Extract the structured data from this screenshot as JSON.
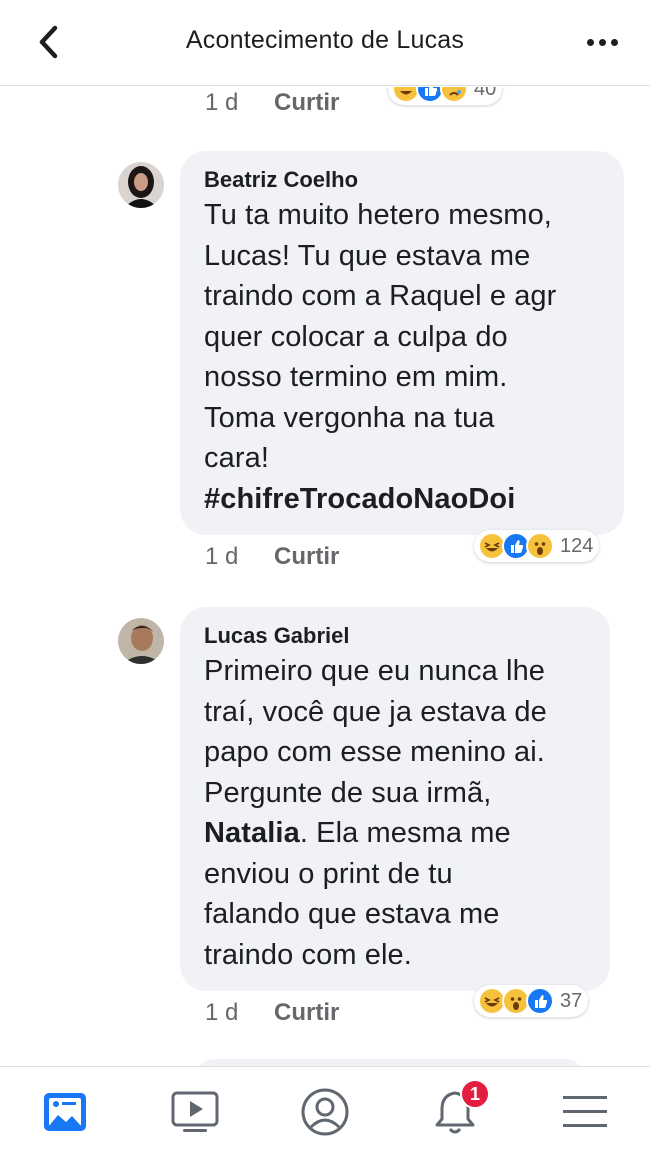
{
  "header": {
    "title": "Acontecimento de Lucas",
    "back_icon": "chevron-left-icon",
    "more_icon": "more-horizontal-icon"
  },
  "comments": [
    {
      "meta": {
        "time": "1 d",
        "like_label": "Curtir"
      },
      "reactions": {
        "icons": [
          "haha",
          "like",
          "sad"
        ],
        "count": "40"
      }
    },
    {
      "author": "Beatriz Coelho",
      "text_lines": [
        "Tu ta muito hetero mesmo,",
        "Lucas! Tu que estava me",
        "traindo com a Raquel e agr",
        "quer colocar a culpa do",
        "nosso termino em mim.",
        "Toma vergonha na tua",
        "cara!"
      ],
      "hashtag": "#chifreTrocadoNaoDoi",
      "meta": {
        "time": "1 d",
        "like_label": "Curtir"
      },
      "reactions": {
        "icons": [
          "haha",
          "like",
          "wow"
        ],
        "count": "124"
      }
    },
    {
      "author": "Lucas Gabriel",
      "text_lines": [
        "Primeiro que eu nunca lhe",
        "traí, você que ja estava de",
        "papo com esse menino ai.",
        "Pergunte de sua irmã,"
      ],
      "mention": "Natalia",
      "mention_suffix": ". Ela mesma me",
      "text_lines_after": [
        "enviou o print de tu",
        "falando que estava me",
        "traindo com ele."
      ],
      "meta": {
        "time": "1 d",
        "like_label": "Curtir"
      },
      "reactions": {
        "icons": [
          "haha",
          "wow",
          "like"
        ],
        "count": "37"
      }
    }
  ],
  "bottom_nav": {
    "items": [
      "news-feed-icon",
      "video-icon",
      "profile-icon",
      "notifications-icon",
      "menu-icon"
    ],
    "notification_badge": "1",
    "accent_color": "#1877f2",
    "badge_color": "#e41e3f"
  }
}
